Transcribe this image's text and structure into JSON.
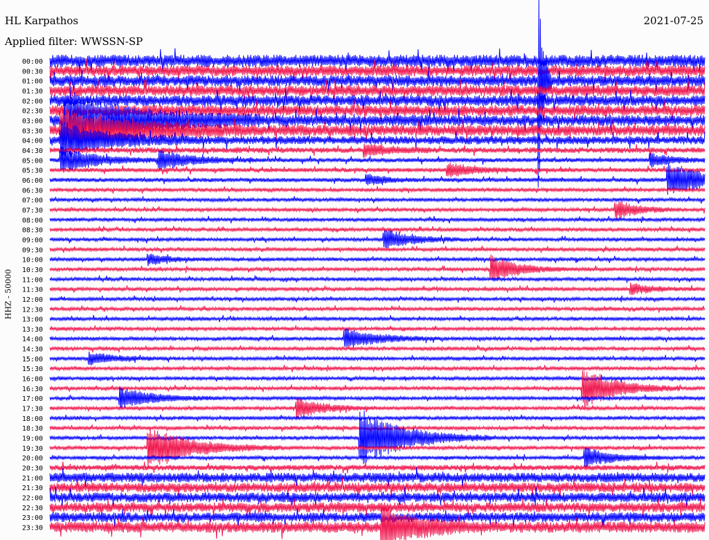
{
  "header": {
    "station": "HL Karpathos",
    "filter": "Applied filter: WWSSN-SP",
    "date": "2021-07-25"
  },
  "chart_data": {
    "type": "line",
    "title": "HL Karpathos",
    "ylabel": "HHZ - 50000",
    "xlabel": "",
    "minutes_per_line": 30,
    "colors": [
      "#0000ff",
      "#f0144c"
    ],
    "row_labels": [
      "00:00",
      "00:30",
      "01:00",
      "01:30",
      "02:00",
      "02:30",
      "03:00",
      "03:30",
      "04:00",
      "04:30",
      "05:00",
      "05:30",
      "06:00",
      "06:30",
      "07:00",
      "07:30",
      "08:00",
      "08:30",
      "09:00",
      "09:30",
      "10:00",
      "10:30",
      "11:00",
      "11:30",
      "12:00",
      "12:30",
      "13:00",
      "13:30",
      "14:00",
      "14:30",
      "15:00",
      "15:30",
      "16:00",
      "16:30",
      "17:00",
      "17:30",
      "18:00",
      "18:30",
      "19:00",
      "19:30",
      "20:00",
      "20:30",
      "21:00",
      "21:30",
      "22:00",
      "22:30",
      "23:00",
      "23:30"
    ],
    "noise_level": [
      9,
      8,
      8,
      8,
      8,
      8,
      8,
      8,
      6,
      4,
      3,
      3,
      3,
      2.5,
      2.5,
      2.5,
      2.5,
      2.5,
      2.5,
      2.5,
      2.5,
      2.5,
      2.5,
      2.5,
      2.5,
      2.5,
      2.5,
      2.5,
      2.5,
      2.5,
      2.5,
      2.5,
      2.5,
      2.5,
      2.5,
      2.5,
      2.5,
      2.5,
      2.5,
      2.5,
      2.5,
      4,
      7,
      7,
      7,
      7,
      7,
      8
    ],
    "events": [
      {
        "row": 6,
        "minute": 0.7,
        "amp": 40,
        "duration": 3
      },
      {
        "row": 7,
        "minute": 0.5,
        "amp": 30,
        "duration": 3
      },
      {
        "row": 8,
        "minute": 0.5,
        "amp": 25,
        "duration": 2
      },
      {
        "row": 10,
        "minute": 0.5,
        "amp": 20,
        "duration": 1.5
      },
      {
        "row": 10,
        "minute": 5.0,
        "amp": 14,
        "duration": 1.5
      },
      {
        "row": 9,
        "minute": 14.4,
        "amp": 9,
        "duration": 1
      },
      {
        "row": 10,
        "minute": 27.5,
        "amp": 10,
        "duration": 1
      },
      {
        "row": 11,
        "minute": 18.2,
        "amp": 10,
        "duration": 1.2
      },
      {
        "row": 12,
        "minute": 28.3,
        "amp": 22,
        "duration": 2
      },
      {
        "row": 12,
        "minute": 14.5,
        "amp": 8,
        "duration": 0.8
      },
      {
        "row": 15,
        "minute": 25.9,
        "amp": 14,
        "duration": 1
      },
      {
        "row": 18,
        "minute": 15.3,
        "amp": 15,
        "duration": 1.2
      },
      {
        "row": 20,
        "minute": 4.5,
        "amp": 8,
        "duration": 1
      },
      {
        "row": 21,
        "minute": 20.2,
        "amp": 20,
        "duration": 1.2
      },
      {
        "row": 23,
        "minute": 26.6,
        "amp": 8,
        "duration": 1
      },
      {
        "row": 28,
        "minute": 13.5,
        "amp": 15,
        "duration": 1.5
      },
      {
        "row": 30,
        "minute": 1.8,
        "amp": 9,
        "duration": 1.2
      },
      {
        "row": 33,
        "minute": 24.4,
        "amp": 30,
        "duration": 1.5
      },
      {
        "row": 34,
        "minute": 3.2,
        "amp": 15,
        "duration": 1.5
      },
      {
        "row": 35,
        "minute": 11.3,
        "amp": 15,
        "duration": 1.2
      },
      {
        "row": 38,
        "minute": 14.2,
        "amp": 42,
        "duration": 2
      },
      {
        "row": 39,
        "minute": 4.5,
        "amp": 30,
        "duration": 2
      },
      {
        "row": 40,
        "minute": 24.5,
        "amp": 15,
        "duration": 1.2
      },
      {
        "row": 47,
        "minute": 15.2,
        "amp": 30,
        "duration": 1.5
      },
      {
        "row": 2,
        "minute": 22.4,
        "amp": 150,
        "duration": 0.2
      }
    ]
  }
}
